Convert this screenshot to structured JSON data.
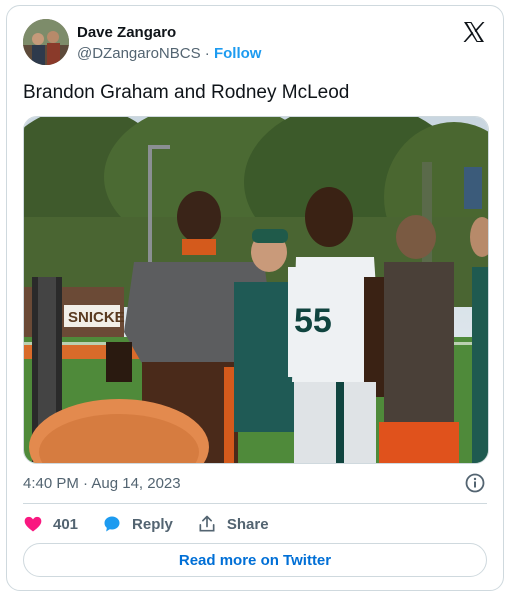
{
  "author": {
    "display_name": "Dave Zangaro",
    "handle": "@DZangaroNBCS",
    "separator": "·",
    "follow_label": "Follow"
  },
  "tweet": {
    "text": "Brandon Graham and Rodney McLeod",
    "timestamp": "4:40 PM · Aug 14, 2023"
  },
  "photo": {
    "banner_text": "SNICKE",
    "jersey_number": "55"
  },
  "actions": {
    "like_count": "401",
    "reply_label": "Reply",
    "share_label": "Share"
  },
  "read_more_label": "Read more on Twitter",
  "colors": {
    "like": "#f91880",
    "reply": "#1d9bf0",
    "link": "#006fd6",
    "muted": "#536471"
  },
  "icons": [
    "x-logo-icon",
    "info-icon",
    "heart-icon",
    "reply-bubble-icon",
    "share-icon"
  ]
}
